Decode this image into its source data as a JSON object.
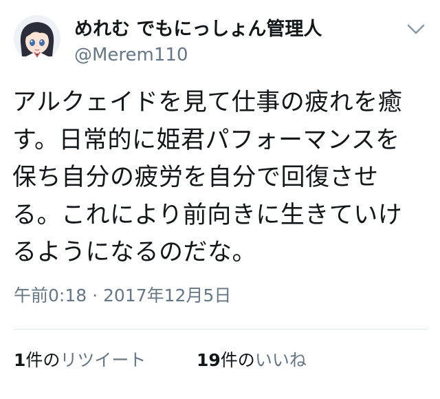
{
  "tweet": {
    "author": {
      "display_name": "めれむ でもにっしょん管理人",
      "handle": "@Merem110"
    },
    "menu_icon": "chevron-down-icon",
    "body_lines": [
      "アルクェイドを見て仕事の疲れを癒",
      "す。日常的に姫君パフォーマンスを",
      "保ち自分の疲労を自分で回復させ",
      "る。これにより前向きに生きていけ",
      "るようになるのだな。"
    ],
    "timestamp": "午前0:18 · 2017年12月5日",
    "stats": {
      "retweets": {
        "count": "1",
        "unit": "件の",
        "label": "リツイート"
      },
      "likes": {
        "count": "19",
        "unit": "件の",
        "label": "いいね"
      }
    }
  },
  "colors": {
    "text_primary": "#14171a",
    "text_secondary": "#657786",
    "divider": "#e1e8ed"
  }
}
